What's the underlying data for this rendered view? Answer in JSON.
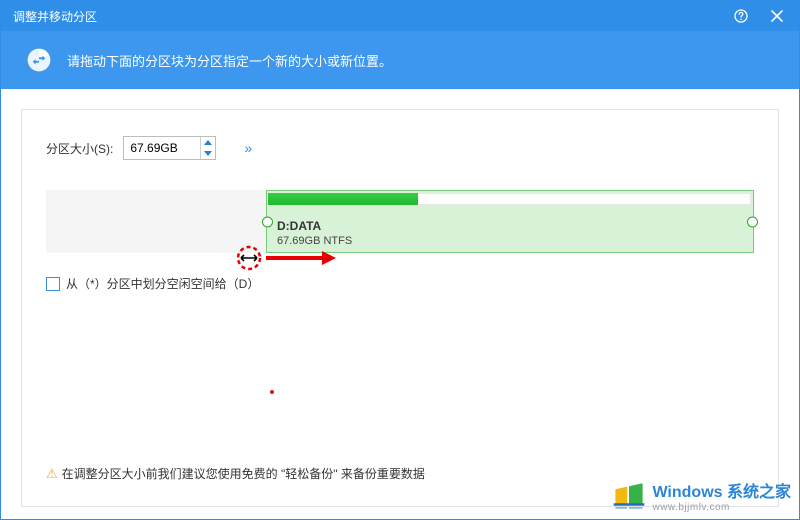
{
  "title": "调整并移动分区",
  "banner": "请拖动下面的分区块为分区指定一个新的大小或新位置。",
  "size_label": "分区大小(S):",
  "size_value": "67.69GB",
  "expand_glyph": "»",
  "partition": {
    "name": "D:DATA",
    "sub": "67.69GB NTFS"
  },
  "checkbox_label": "从（*）分区中划分空闲空间给（D）",
  "warning": "在调整分区大小前我们建议您使用免费的 \"轻松备份\" 来备份重要数据",
  "watermark": {
    "line1": "Windows 系统之家",
    "line2": "www.bjjmlv.com"
  }
}
